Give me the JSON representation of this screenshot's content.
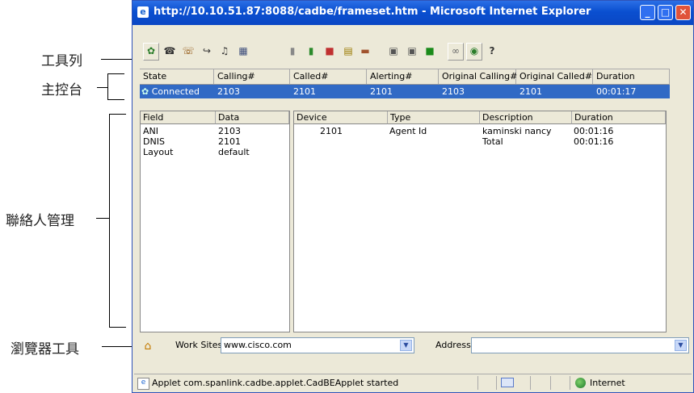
{
  "callouts": {
    "toolbar": "工具列",
    "main_console": "主控台",
    "contact_management": "聯絡人管理",
    "browser_tools": "瀏覽器工具"
  },
  "window": {
    "title": "http://10.10.51.87:8088/cadbe/frameset.htm - Microsoft Internet Explorer",
    "buttons": {
      "minimize": "_",
      "maximize": "□",
      "close": "✕"
    }
  },
  "toolbar": {
    "icons": [
      "agent-state-icon",
      "answer-icon",
      "conference-icon",
      "transfer-icon",
      "music-icon",
      "keypad-icon",
      "record-icon",
      "traffic-light-icon",
      "stop-icon",
      "folder-open-icon",
      "folder-icon",
      "calendar-icon",
      "grid-icon",
      "exit-icon",
      "link-icon",
      "refresh-icon",
      "help-icon"
    ],
    "help_glyph": "?"
  },
  "call_table": {
    "headers": [
      "State",
      "Calling#",
      "Called#",
      "Alerting#",
      "Original Calling#",
      "Original Called#",
      "Duration"
    ],
    "row": [
      "Connected",
      "2103",
      "2101",
      "2101",
      "2103",
      "2101",
      "00:01:17"
    ]
  },
  "field_panel": {
    "headers": [
      "Field",
      "Data"
    ],
    "rows": [
      [
        "ANI",
        "2103"
      ],
      [
        "DNIS",
        "2101"
      ],
      [
        "Layout",
        "default"
      ]
    ]
  },
  "device_panel": {
    "headers": [
      "Device",
      "Type",
      "Description",
      "Duration"
    ],
    "rows": [
      [
        "2101",
        "Agent Id",
        "kaminski nancy",
        "00:01:16"
      ],
      [
        "",
        "",
        "Total",
        "00:01:16"
      ]
    ]
  },
  "browser_bar": {
    "work_sites_label": "Work Sites",
    "work_sites_value": "www.cisco.com",
    "address_label": "Address",
    "address_value": ""
  },
  "status_bar": {
    "text": "Applet com.spanlink.cadbe.applet.CadBEApplet started",
    "zone": "Internet"
  },
  "colors": {
    "titlebar": "#0a4fd0",
    "selection": "#316ac5",
    "chrome": "#ece9d8"
  }
}
